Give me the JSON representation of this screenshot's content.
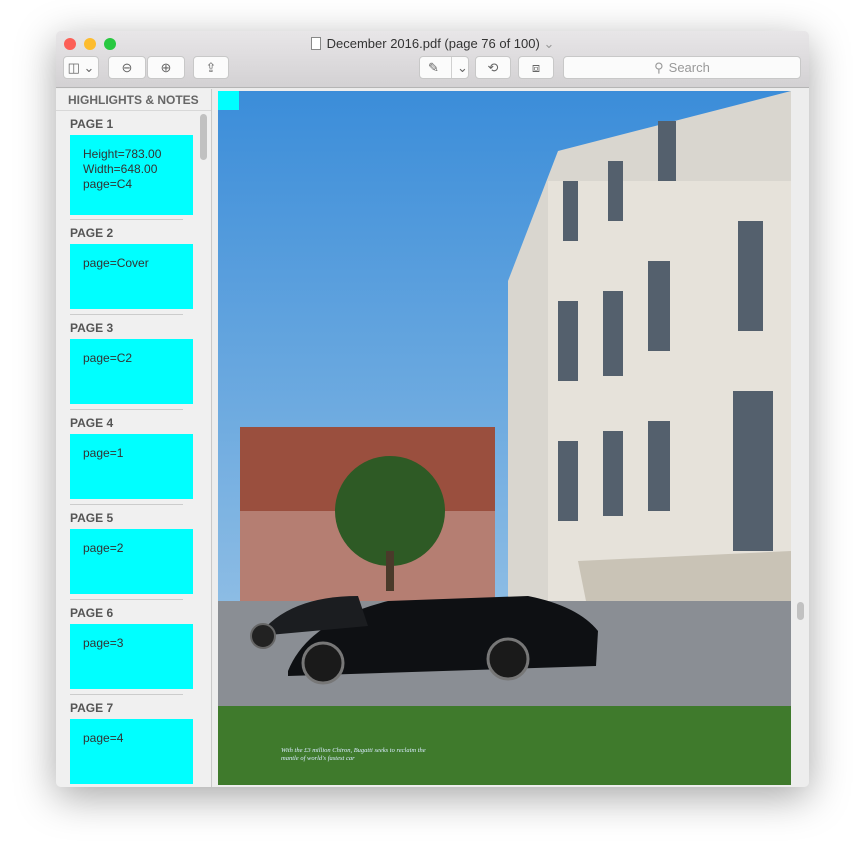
{
  "window": {
    "title": "December 2016.pdf (page 76 of 100)"
  },
  "toolbar": {
    "search_placeholder": "Search",
    "icons": [
      "sidebar-icon",
      "zoom-out-icon",
      "zoom-in-icon",
      "share-icon",
      "markup-pen-icon",
      "rotate-icon",
      "toolbox-icon"
    ]
  },
  "sidebar": {
    "header": "HIGHLIGHTS & NOTES",
    "pages": [
      {
        "label": "PAGE 1",
        "note": "Height=783.00\nWidth=648.00\npage=C4"
      },
      {
        "label": "PAGE 2",
        "note": "page=Cover"
      },
      {
        "label": "PAGE 3",
        "note": "page=C2"
      },
      {
        "label": "PAGE 4",
        "note": "page=1"
      },
      {
        "label": "PAGE 5",
        "note": "page=2"
      },
      {
        "label": "PAGE 6",
        "note": "page=3"
      },
      {
        "label": "PAGE 7",
        "note": "page=4"
      }
    ],
    "highlight_color": "#00ffff"
  },
  "document": {
    "caption": "With the £3 million Chiron, Bugatti seeks to reclaim the mantle of world's fastest car"
  }
}
